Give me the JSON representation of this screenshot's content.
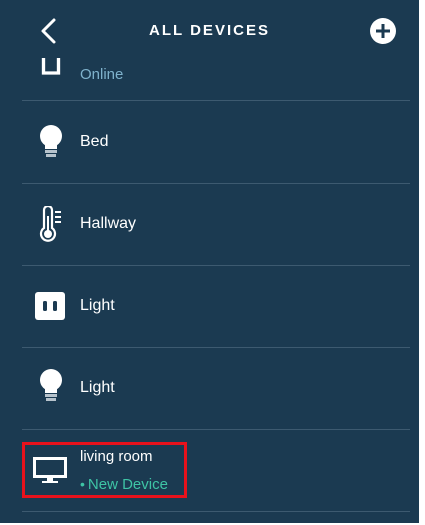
{
  "header": {
    "title": "ALL DEVICES"
  },
  "devices": [
    {
      "name": "",
      "status": "Online",
      "icon": "hub-icon"
    },
    {
      "name": "Bed",
      "status": "",
      "icon": "light-bulb-icon"
    },
    {
      "name": "Hallway",
      "status": "",
      "icon": "thermostat-icon"
    },
    {
      "name": "Light",
      "status": "",
      "icon": "smart-plug-icon"
    },
    {
      "name": "Light",
      "status": "",
      "icon": "light-bulb-icon"
    },
    {
      "name": "living room",
      "status": "New Device",
      "icon": "tv-icon"
    }
  ],
  "colors": {
    "background": "#1b3a51",
    "online": "#7fb2cc",
    "new_device": "#3ec4a5",
    "highlight": "#e8121c"
  }
}
